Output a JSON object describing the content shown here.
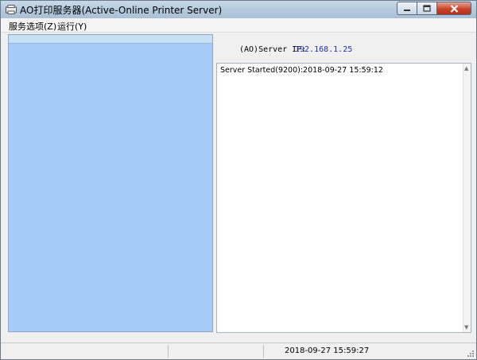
{
  "window": {
    "title": "AO打印服务器(Active-Online Printer Server)"
  },
  "menu": {
    "items": [
      "服务选项(Z)",
      "运行(Y)"
    ]
  },
  "server": {
    "ip_label": "(AO)Server IP:",
    "ip_value": "192.168.1.25"
  },
  "log": {
    "lines": [
      "Server Started(9200):2018-09-27 15:59:12"
    ]
  },
  "status": {
    "time": "2018-09-27 15:59:27"
  },
  "colors": {
    "left_panel": "#a6cbf8",
    "ip_value": "#1c2fb5"
  },
  "icons": [
    "app-icon",
    "minimize-icon",
    "maximize-icon",
    "close-icon",
    "scroll-up-icon",
    "scroll-down-icon",
    "size-grip-icon"
  ]
}
